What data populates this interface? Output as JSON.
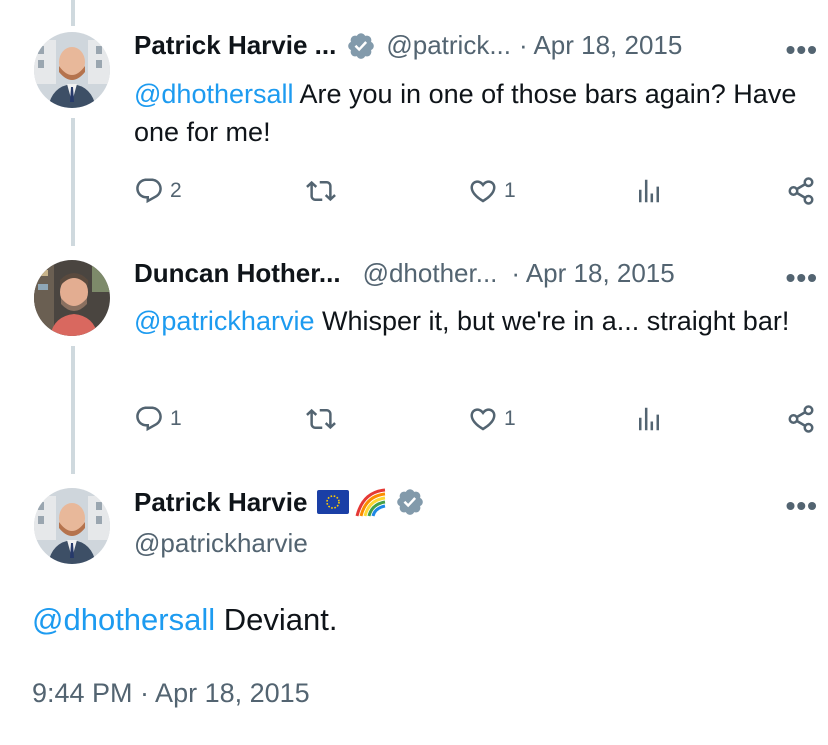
{
  "colors": {
    "link": "#1d9bf0",
    "muted": "#536471",
    "thread_line": "#cfd9de",
    "verified": "#829aab"
  },
  "tweets": [
    {
      "author": "Patrick Harvie ...",
      "handle": "@patrick...",
      "date": "· Apr 18, 2015",
      "more": "•••",
      "mention": "@dhothersall",
      "text": " Are you in one of those bars again? Have one for me!",
      "replies": "2",
      "likes": "1",
      "icons": [
        "reply-icon",
        "retweet-icon",
        "like-icon",
        "views-icon",
        "share-icon"
      ]
    },
    {
      "author": "Duncan Hother...",
      "handle": "@dhother...",
      "date": "· Apr 18, 2015",
      "more": "•••",
      "mention": "@patrickharvie",
      "text": " Whisper it, but we're in a... straight bar!",
      "replies": "1",
      "likes": "1",
      "icons": [
        "reply-icon",
        "retweet-icon",
        "like-icon",
        "views-icon",
        "share-icon"
      ]
    }
  ],
  "main_tweet": {
    "author": "Patrick Harvie",
    "handle": "@patrickharvie",
    "more": "•••",
    "emoji": [
      "eu-flag-icon",
      "rainbow-icon"
    ],
    "mention": "@dhothersall",
    "text": " Deviant.",
    "timestamp": "9:44 PM · Apr 18, 2015"
  }
}
